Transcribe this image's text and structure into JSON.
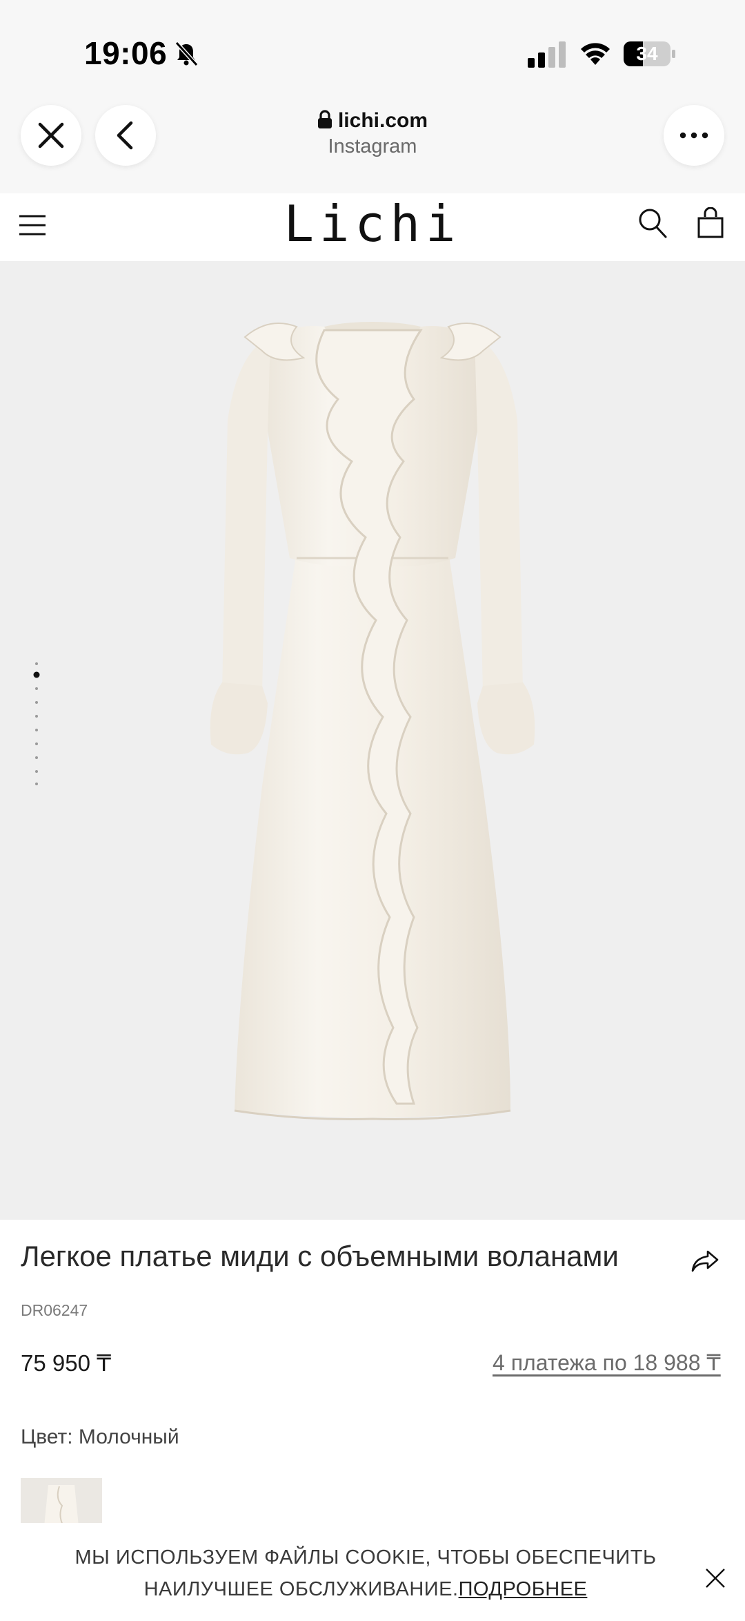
{
  "status_bar": {
    "time": "19:06",
    "battery": "34"
  },
  "browser": {
    "url": "lichi.com",
    "source": "Instagram"
  },
  "site": {
    "logo": "Lichi"
  },
  "product": {
    "title": "Легкое платье миди с объемными воланами",
    "sku": "DR06247",
    "price": "75 950 ₸",
    "installments": "4 платежа по 18 988 ₸",
    "color_label": "Цвет: Молочный",
    "image_count": 9,
    "active_image": 1
  },
  "cookie": {
    "text": "МЫ ИСПОЛЬЗУЕМ ФАЙЛЫ COOKIE, ЧТОБЫ ОБЕСПЕЧИТЬ НАИЛУЧШЕЕ ОБСЛУЖИВАНИЕ.",
    "link": "ПОДРОБНЕЕ"
  },
  "colors": {
    "image_bg": "#efefef",
    "dress": "#f6f2ea"
  }
}
